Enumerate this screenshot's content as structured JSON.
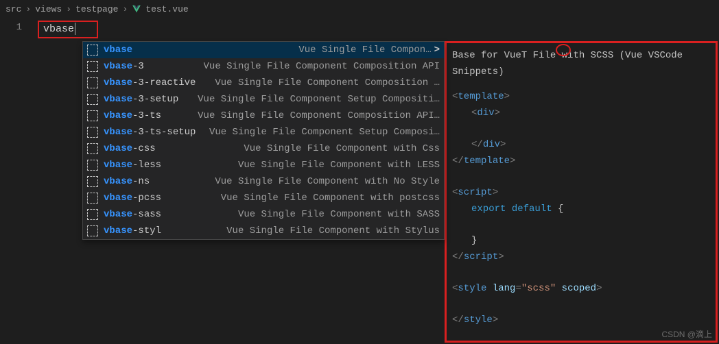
{
  "breadcrumb": {
    "part1": "src",
    "part2": "views",
    "part3": "testpage",
    "file": "test.vue"
  },
  "editor": {
    "line_number": "1",
    "typed": "vbase"
  },
  "suggestions": [
    {
      "match": "vbase",
      "suffix": "",
      "desc": "Vue Single File Compon…",
      "selected": true
    },
    {
      "match": "vbase",
      "suffix": "-3",
      "desc": "Vue Single File Component Composition API"
    },
    {
      "match": "vbase",
      "suffix": "-3-reactive",
      "desc": "Vue Single File Component Composition …"
    },
    {
      "match": "vbase",
      "suffix": "-3-setup",
      "desc": "Vue Single File Component Setup Compositi…"
    },
    {
      "match": "vbase",
      "suffix": "-3-ts",
      "desc": "Vue Single File Component Composition API…"
    },
    {
      "match": "vbase",
      "suffix": "-3-ts-setup",
      "desc": "Vue Single File Component Setup Composi…"
    },
    {
      "match": "vbase",
      "suffix": "-css",
      "desc": "Vue Single File Component with Css"
    },
    {
      "match": "vbase",
      "suffix": "-less",
      "desc": "Vue Single File Component with LESS"
    },
    {
      "match": "vbase",
      "suffix": "-ns",
      "desc": "Vue Single File Component with No Style"
    },
    {
      "match": "vbase",
      "suffix": "-pcss",
      "desc": "Vue Single File Component with postcss"
    },
    {
      "match": "vbase",
      "suffix": "-sass",
      "desc": "Vue Single File Component with SASS"
    },
    {
      "match": "vbase",
      "suffix": "-styl",
      "desc": "Vue Single File Component with Stylus"
    }
  ],
  "detail": {
    "title_pre": "Base for Vue",
    "title_circled": "T",
    "title_post": " File with SCSS (Vue VSCode Snippets)",
    "tmpl_open": "template",
    "div": "div",
    "script": "script",
    "export_kw": "export",
    "default_kw": "default",
    "brace_open": "{",
    "brace_close": "}",
    "style": "style",
    "lang_attr": "lang",
    "lang_val": "\"scss\"",
    "scoped": "scoped"
  },
  "watermark": "CSDN @滴上"
}
